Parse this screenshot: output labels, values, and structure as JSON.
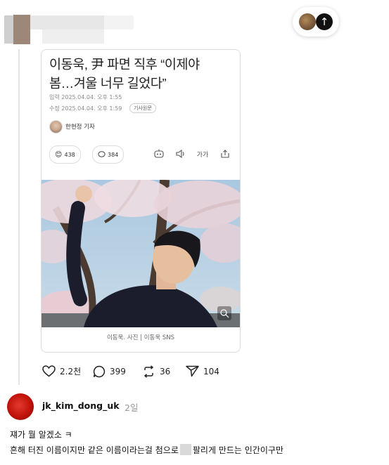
{
  "header": {
    "avatar_icon": "user-avatar-icon",
    "username_redacted": true
  },
  "floating": {
    "avatar_icon": "cat-avatar-icon",
    "up_icon": "arrow-up-icon",
    "up_glyph": "↑"
  },
  "article": {
    "title": "이동욱, 尹 파면 직후 “이제야\n봄…겨울 너무 길었다”",
    "input_date": "입력 2025.04.04. 오후 1:55",
    "modified_date": "수정 2025.04.04. 오후 1:59",
    "original_label": "기사원문",
    "reporter": "한현정 기자",
    "reaction_count": "438",
    "comment_count": "384",
    "text_size_label": "가가",
    "caption": "이동욱. 사진 | 이동욱 SNS",
    "colors": {
      "sky": "#b7d0e4",
      "blossom": "#ecd9dc",
      "shirt": "#1b1d2c"
    }
  },
  "actions": {
    "like_count": "2.2천",
    "comment_count": "399",
    "repost_count": "36",
    "share_count": "104"
  },
  "reply": {
    "username": "jk_kim_dong_uk",
    "time": "2일",
    "line1": "쟤가 뭘 알겠소 ㅋ",
    "line2_before": "흔해 터진 이름이지만 같은 이름이라는걸 첨으로",
    "line2_after": "팔리게 만드는 인간이구만"
  }
}
